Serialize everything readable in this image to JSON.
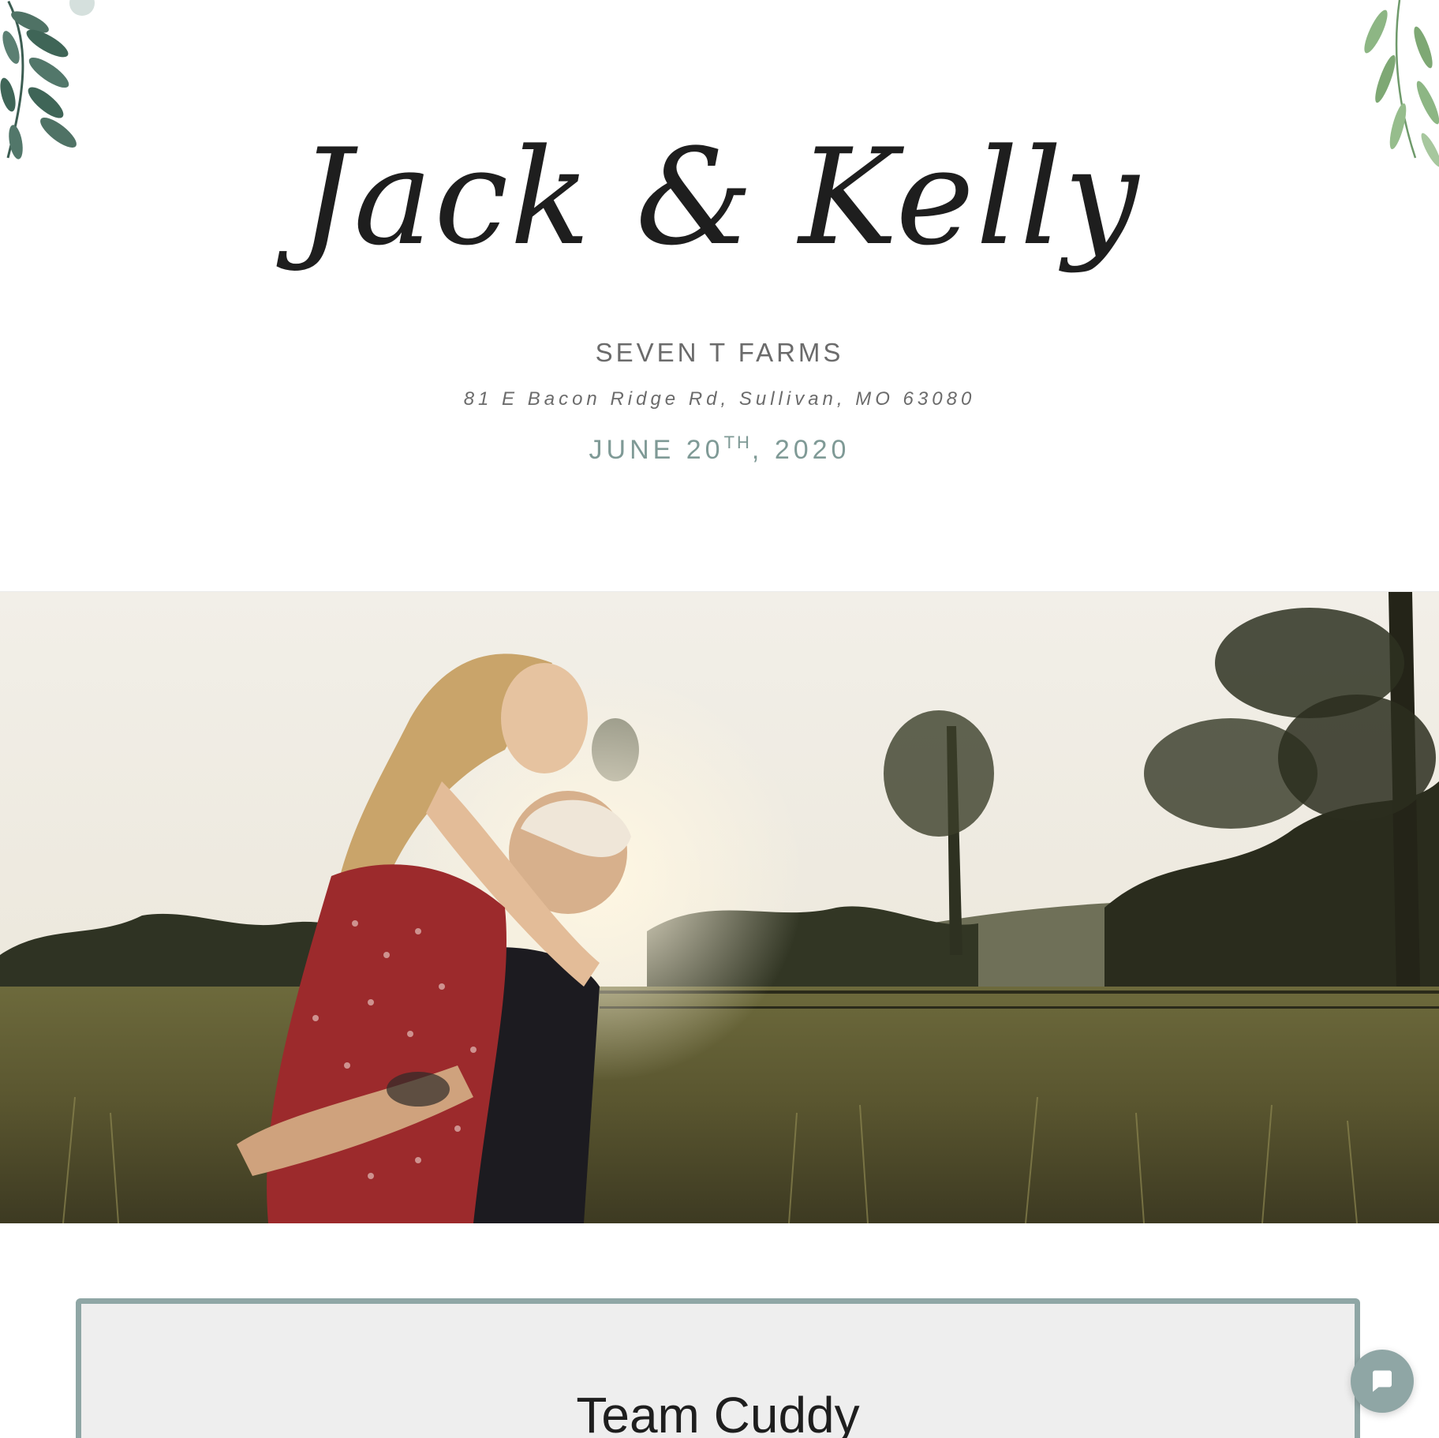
{
  "header": {
    "names": "Jack & Kelly",
    "venue": "SEVEN T FARMS",
    "address": "81 E Bacon Ridge Rd, Sullivan, MO 63080",
    "date_prefix": "JUNE 20",
    "date_ordinal": "TH",
    "date_suffix": ", 2020"
  },
  "hero": {
    "image_alt": "Couple embracing in a sunlit field at sunset"
  },
  "team_section": {
    "title": "Team Cuddy"
  },
  "chat": {
    "icon": "chat-bubble-icon"
  },
  "colors": {
    "accent": "#8fa6a5",
    "date_text": "#7f9a96",
    "heading_text": "#1e1e1e",
    "muted_text": "#6b6b6b",
    "panel_bg": "#eeeeee"
  }
}
